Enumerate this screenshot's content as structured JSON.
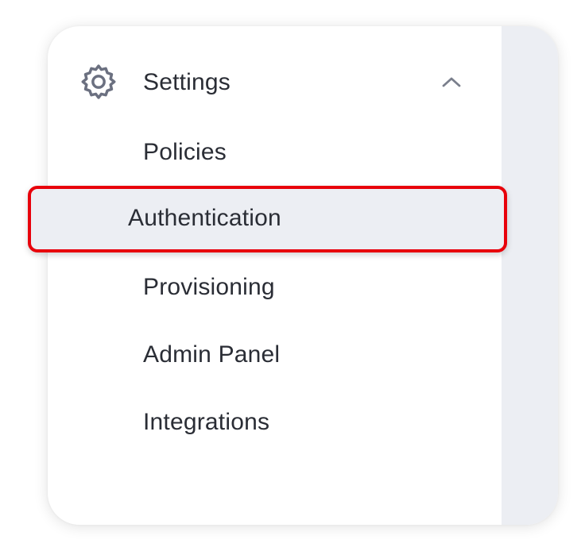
{
  "sidebar": {
    "section": {
      "label": "Settings",
      "icon": "gear-icon",
      "expanded": true,
      "chevron_icon": "chevron-up-icon"
    },
    "items": [
      {
        "label": "Policies",
        "active": false
      },
      {
        "label": "Authentication",
        "active": true
      },
      {
        "label": "Provisioning",
        "active": false
      },
      {
        "label": "Admin Panel",
        "active": false
      },
      {
        "label": "Integrations",
        "active": false
      }
    ]
  },
  "colors": {
    "text": "#2a2d35",
    "icon": "#6b7080",
    "highlight_border": "#e8000b",
    "active_background": "#eceef3",
    "panel_background": "#eceef3"
  }
}
